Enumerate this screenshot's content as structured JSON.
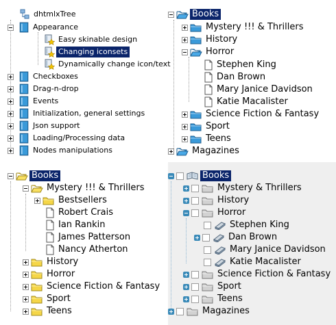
{
  "colors": {
    "selection_bg": "#0a246a",
    "selection_text": "#ffffff",
    "panel4_bg": "#efefef",
    "blue_folder": "#3a9ad9",
    "yellow_folder": "#f5d648",
    "toggle_blue": "#3a8ab8"
  },
  "tree1": {
    "root": "dhtmlxTree",
    "appearance": "Appearance",
    "appearance_items": [
      "Easy skinable design",
      "Changing iconsets",
      "Dynamically change icon/text"
    ],
    "items": [
      "Checkboxes",
      "Drag-n-drop",
      "Events",
      "Initialization, general settings",
      "Json support",
      "Loading/Processing data",
      "Nodes manipulations"
    ]
  },
  "tree2": {
    "root": "Books",
    "mystery": "Mystery !!! & Thrillers",
    "history": "History",
    "horror": "Horror",
    "horror_items": [
      "Stephen King",
      "Dan Brown",
      "Mary Janice Davidson",
      "Katie Macalister"
    ],
    "scifi": "Science Fiction & Fantasy",
    "sport": "Sport",
    "teens": "Teens",
    "magazines": "Magazines"
  },
  "tree3": {
    "root": "Books",
    "mystery": "Mystery !!! & Thrillers",
    "bestsellers": "Bestsellers",
    "mystery_items": [
      "Robert Crais",
      "Ian Rankin",
      "James Patterson",
      "Nancy Atherton"
    ],
    "history": "History",
    "horror": "Horror",
    "scifi": "Science Fiction & Fantasy",
    "sport": "Sport",
    "teens": "Teens"
  },
  "tree4": {
    "root": "Books",
    "mystery": "Mystery & Thrillers",
    "history": "History",
    "horror": "Horror",
    "horror_items": [
      "Stephen King",
      "Dan Brown",
      "Mary Janice Davidson",
      "Katie Macalister"
    ],
    "scifi": "Science Fiction & Fantasy",
    "sport": "Sport",
    "teens": "Teens",
    "magazines": "Magazines"
  }
}
